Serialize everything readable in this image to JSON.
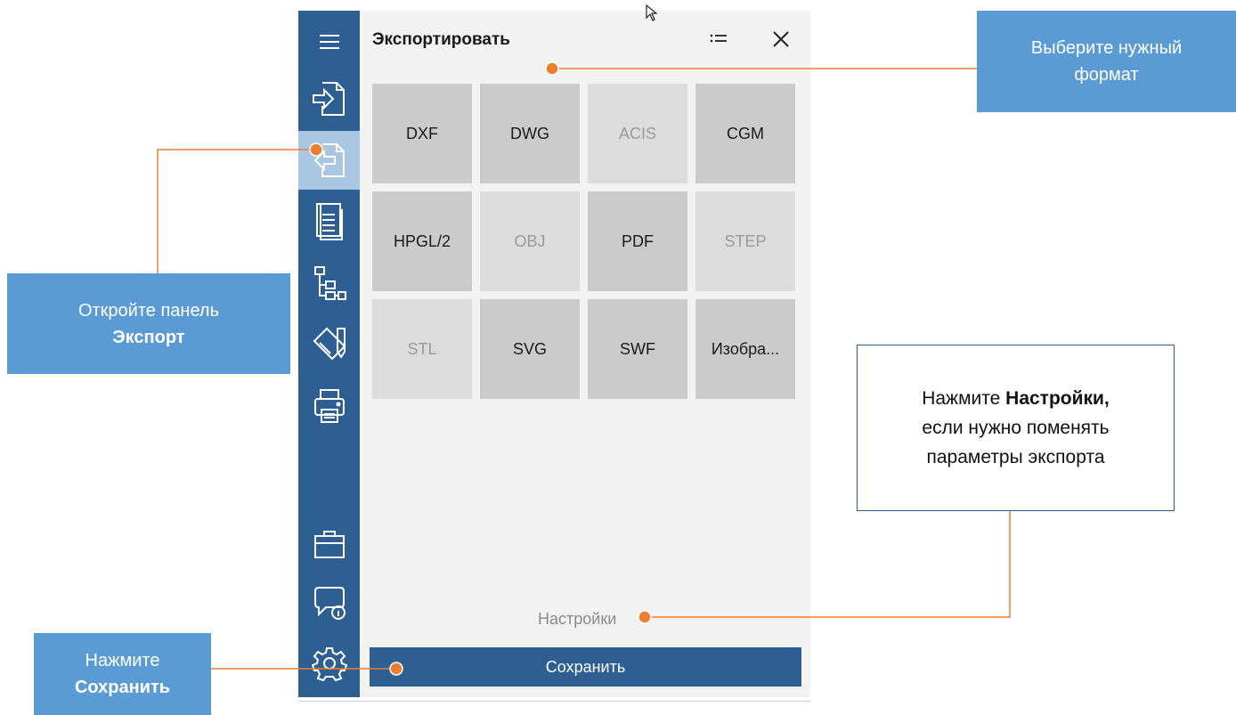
{
  "panel": {
    "title": "Экспортировать",
    "settings_label": "Настройки",
    "save_label": "Сохранить",
    "formats": [
      {
        "label": "DXF",
        "enabled": true
      },
      {
        "label": "DWG",
        "enabled": true
      },
      {
        "label": "ACIS",
        "enabled": false
      },
      {
        "label": "CGM",
        "enabled": true
      },
      {
        "label": "HPGL/2",
        "enabled": true
      },
      {
        "label": "OBJ",
        "enabled": false
      },
      {
        "label": "PDF",
        "enabled": true
      },
      {
        "label": "STEP",
        "enabled": false
      },
      {
        "label": "STL",
        "enabled": false
      },
      {
        "label": "SVG",
        "enabled": true
      },
      {
        "label": "SWF",
        "enabled": true
      },
      {
        "label": "Изобра...",
        "enabled": true
      }
    ]
  },
  "sidebar": {
    "items": [
      {
        "icon": "menu-icon"
      },
      {
        "icon": "import-icon"
      },
      {
        "icon": "export-icon",
        "active": true
      },
      {
        "icon": "document-icon"
      },
      {
        "icon": "tree-icon"
      },
      {
        "icon": "drawing-icon"
      },
      {
        "icon": "printer-icon"
      },
      {
        "icon": "briefcase-icon"
      },
      {
        "icon": "feedback-icon"
      },
      {
        "icon": "gear-icon"
      }
    ]
  },
  "callouts": {
    "format": {
      "line1": "Выберите нужный",
      "line2": "формат"
    },
    "export": {
      "line1": "Откройте панель",
      "line2": "Экспорт"
    },
    "settings": {
      "line1_pre": "Нажмите ",
      "line1_bold": "Настройки,",
      "line2": "если нужно поменять",
      "line3": "параметры экспорта"
    },
    "save": {
      "line1": "Нажмите",
      "line2_pre": "С",
      "line2_bold": "охранить"
    }
  },
  "colors": {
    "sidebar": "#2e5f92",
    "sidebar_active": "#a9c7e2",
    "callout_fill": "#5b9bd5",
    "connector": "#ed7d31",
    "tile": "#cbcbcb",
    "tile_disabled": "#dcdcdc"
  }
}
